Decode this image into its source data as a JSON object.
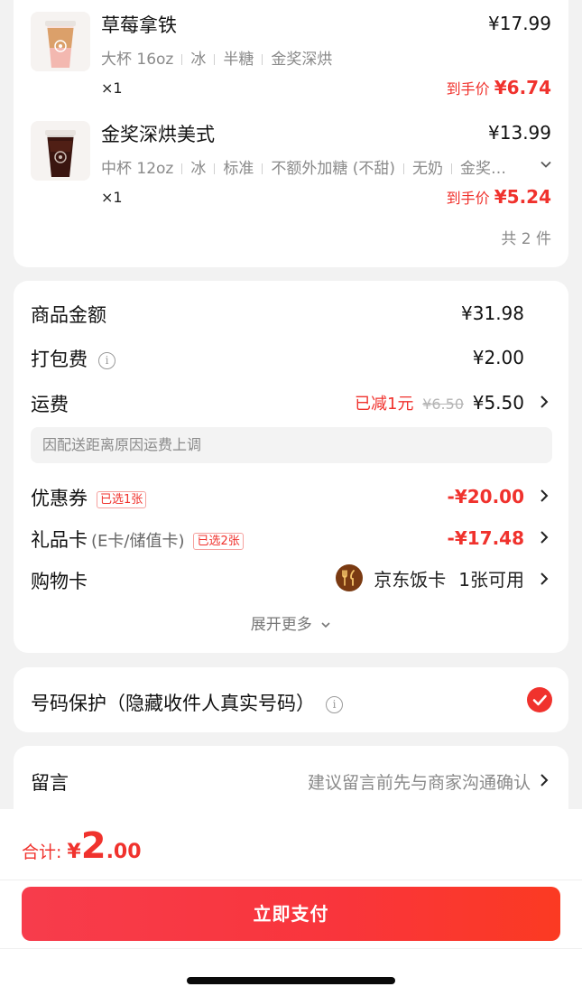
{
  "products": [
    {
      "name": "草莓拿铁",
      "price": "¥17.99",
      "specs": [
        "大杯 16oz",
        "冰",
        "半糖",
        "金奖深烘"
      ],
      "qty": "×1",
      "final_label": "到手价 ",
      "final_price": "¥6.74",
      "has_expand": false
    },
    {
      "name": "金奖深烘美式",
      "price": "¥13.99",
      "specs": [
        "中杯 12oz",
        "冰",
        "标准",
        "不额外加糖 (不甜)",
        "无奶",
        "金奖…"
      ],
      "qty": "×1",
      "final_label": "到手价 ",
      "final_price": "¥5.24",
      "has_expand": true
    }
  ],
  "product_count": "共 2 件",
  "fees": {
    "subtotal_label": "商品金额",
    "subtotal_value": "¥31.98",
    "packing_label": "打包费",
    "packing_value": "¥2.00",
    "delivery_label": "运费",
    "delivery_discount": "已减1元",
    "delivery_original": "¥6.50",
    "delivery_value": "¥5.50",
    "delivery_notice": "因配送距离原因运费上调",
    "coupon_label": "优惠券",
    "coupon_tag": "已选1张",
    "coupon_value": "-¥20.00",
    "giftcard_label": "礼品卡",
    "giftcard_sub": "(E卡/储值卡)",
    "giftcard_tag": "已选2张",
    "giftcard_value": "-¥17.48",
    "shopcard_label": "购物卡",
    "shopcard_name": "京东饭卡",
    "shopcard_avail": "1张可用",
    "expand_more": "展开更多"
  },
  "privacy": {
    "label": "号码保护（隐藏收件人真实号码）",
    "checked": true
  },
  "message": {
    "label": "留言",
    "hint": "建议留言前先与商家沟通确认"
  },
  "total": {
    "label": "合计:",
    "currency": "¥",
    "integer": "2",
    "decimal": ".00"
  },
  "pay_button": "立即支付",
  "colors": {
    "accent_red": "#f0322d",
    "pay_gradient_start": "#f73c4c",
    "pay_gradient_end": "#fb3a22"
  }
}
